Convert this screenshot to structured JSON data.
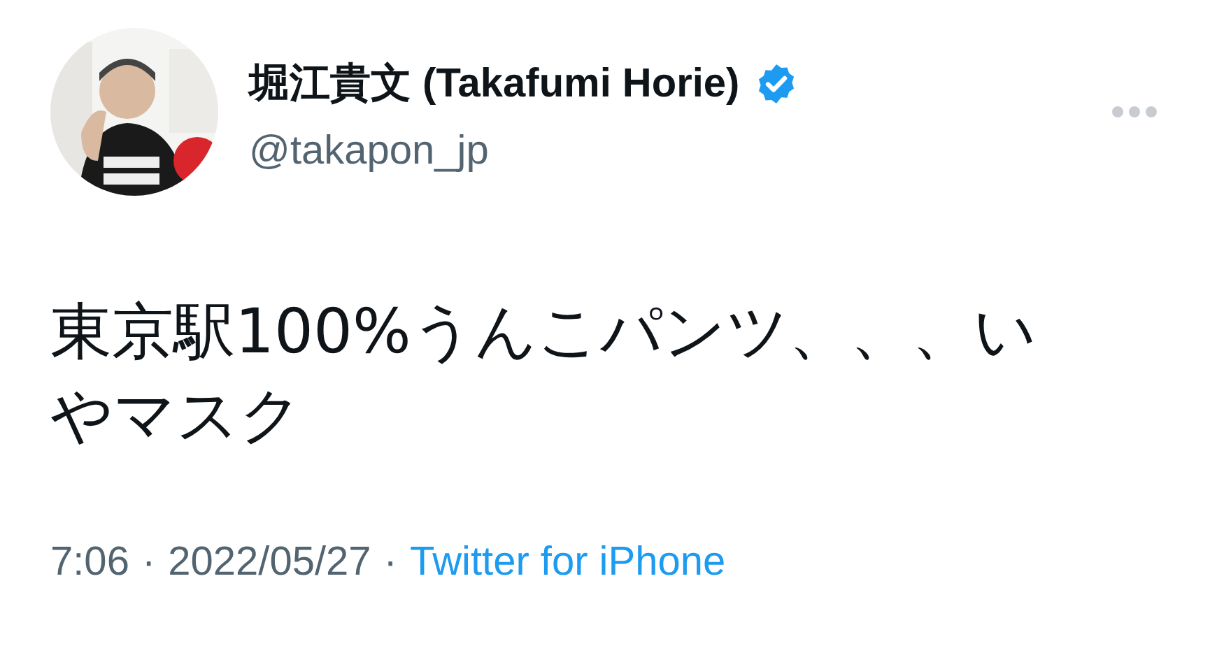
{
  "author": {
    "name": "堀江貴文 (Takafumi Horie)",
    "verified": true,
    "handle": "@takapon_jp"
  },
  "tweet": {
    "text": "東京駅100%うんこパンツ、、、いやマスク"
  },
  "footer": {
    "time": "7:06",
    "separator_1": "·",
    "date": "2022/05/27",
    "separator_2": "·",
    "source": "Twitter for iPhone"
  }
}
